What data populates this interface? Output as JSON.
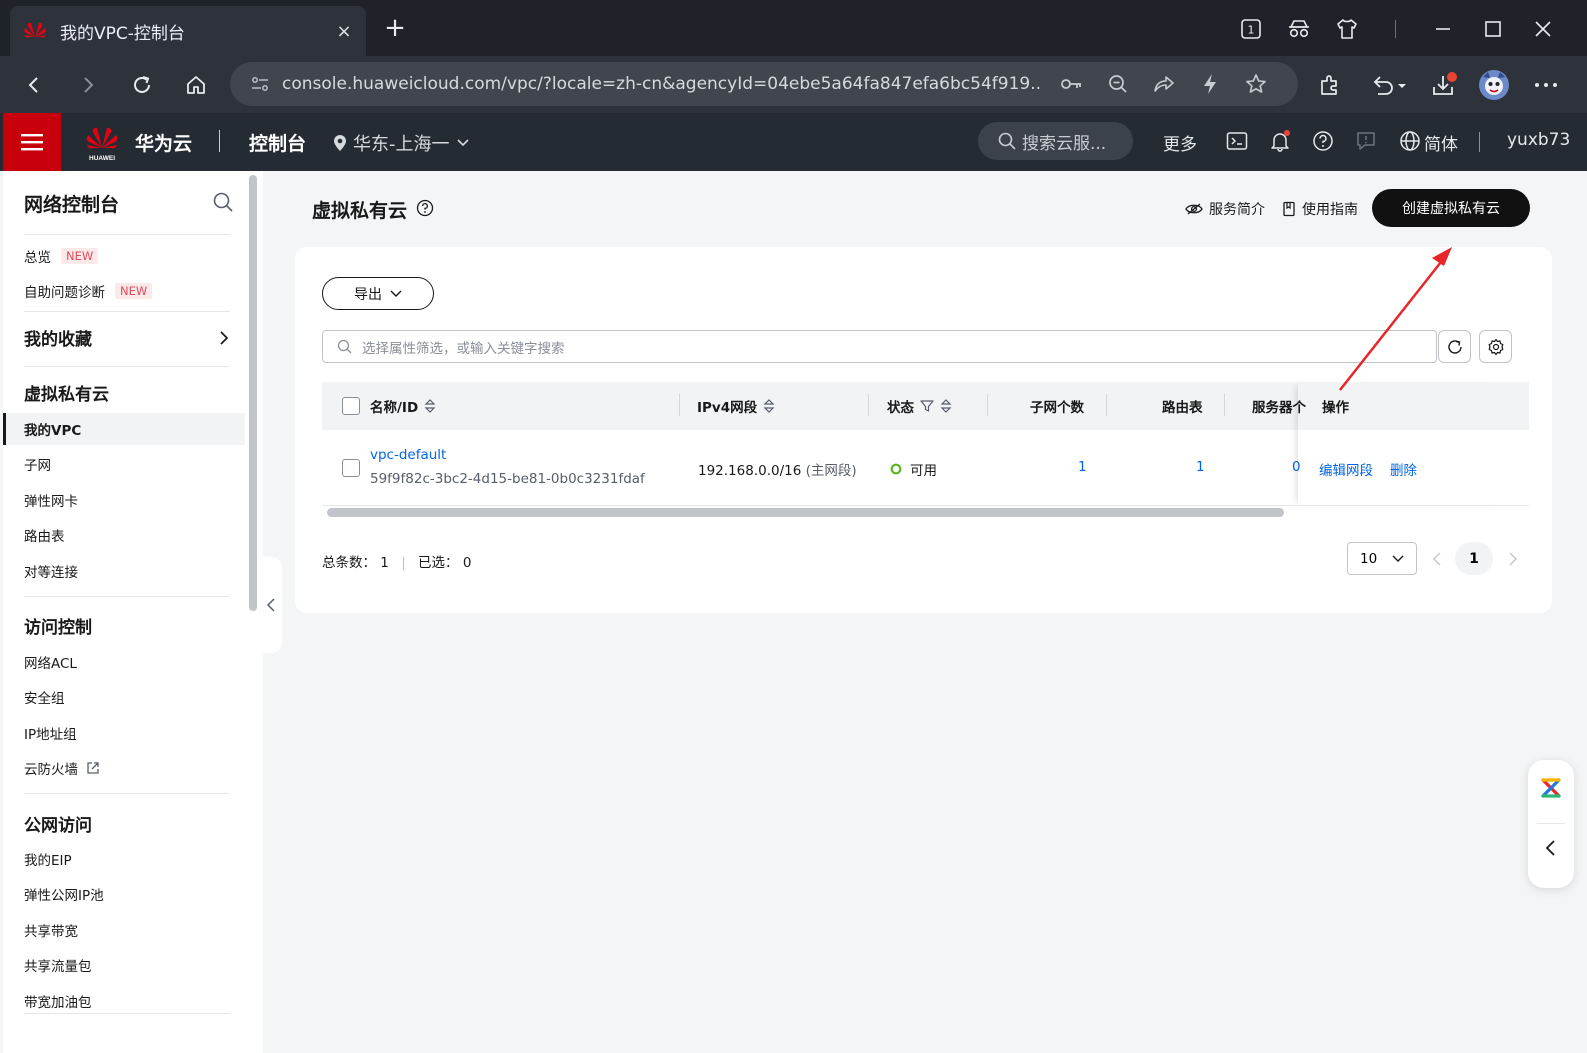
{
  "browser": {
    "tab_title": "我的VPC-控制台",
    "tab_close": "×",
    "new_tab": "+",
    "tab_count": "1",
    "url": "console.huaweicloud.com/vpc/?locale=zh-cn&agencyId=04ebe5a64fa847efa6bc54f919..."
  },
  "topbar": {
    "brand": "华为云",
    "logo_text": "HUAWEI",
    "console": "控制台",
    "region": "华东-上海一",
    "search_placeholder": "搜索云服...",
    "more": "更多",
    "language": "简体",
    "user": "yuxb73"
  },
  "sidebar": {
    "title": "网络控制台",
    "items_top": [
      {
        "label": "总览",
        "badge": "NEW"
      },
      {
        "label": "自助问题诊断",
        "badge": "NEW"
      }
    ],
    "favorites": "我的收藏",
    "groups": [
      {
        "title": "虚拟私有云",
        "items": [
          "我的VPC",
          "子网",
          "弹性网卡",
          "路由表",
          "对等连接"
        ]
      },
      {
        "title": "访问控制",
        "items": [
          "网络ACL",
          "安全组",
          "IP地址组",
          "云防火墙"
        ]
      },
      {
        "title": "公网访问",
        "items": [
          "我的EIP",
          "弹性公网IP池",
          "共享带宽",
          "共享流量包",
          "带宽加油包"
        ]
      }
    ],
    "active_item": "我的VPC"
  },
  "main": {
    "title": "虚拟私有云",
    "service_intro": "服务简介",
    "guide": "使用指南",
    "create_button": "创建虚拟私有云",
    "export_button": "导出",
    "filter_placeholder": "选择属性筛选，或输入关键字搜索",
    "columns": [
      "名称/ID",
      "IPv4网段",
      "状态",
      "子网个数",
      "路由表",
      "服务器个",
      "操作"
    ],
    "rows": [
      {
        "name": "vpc-default",
        "id": "59f9f82c-3bc2-4d15-be81-0b0c3231fdaf",
        "cidr": "192.168.0.0/16",
        "cidr_note": "(主网段)",
        "status": "可用",
        "subnets": "1",
        "route_tables": "1",
        "servers": "0",
        "actions": [
          "编辑网段",
          "删除"
        ]
      }
    ],
    "footer": {
      "total_label": "总条数：",
      "total": "1",
      "selected_label": "已选：",
      "selected": "0",
      "page_size": "10",
      "page": "1"
    }
  },
  "colors": {
    "brand_red": "#c7000b",
    "link_blue": "#0066e6",
    "status_green": "#5eb825",
    "annotation_arrow": "#e8262a"
  }
}
